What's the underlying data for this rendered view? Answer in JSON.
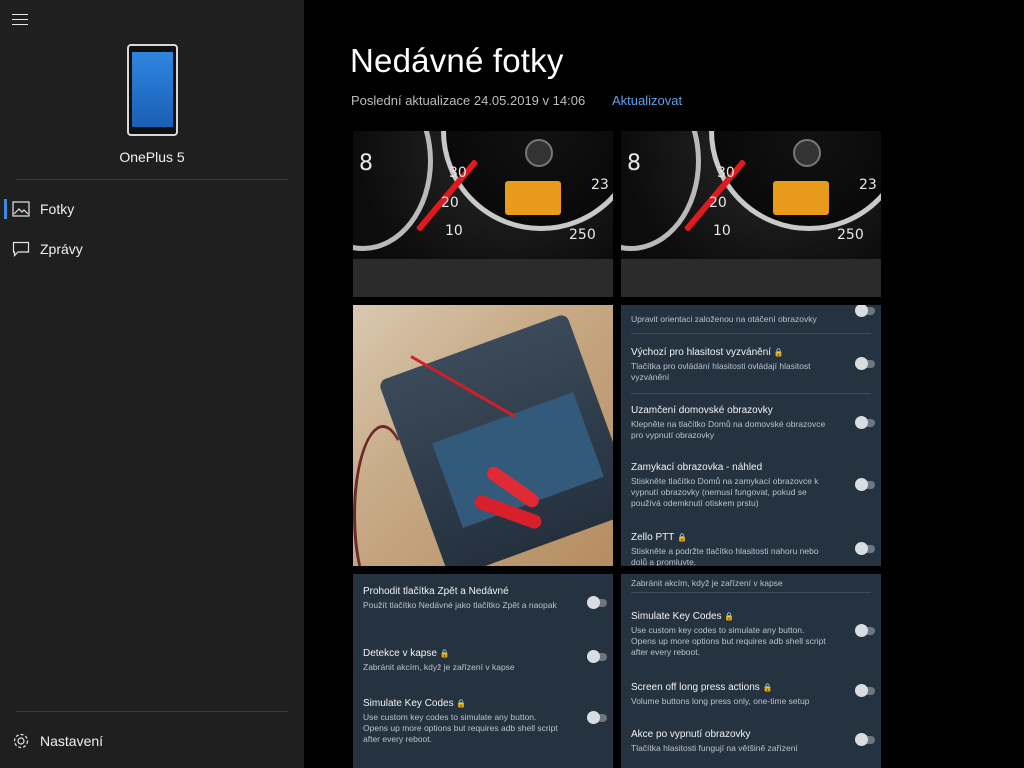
{
  "sidebar": {
    "device_name": "OnePlus 5",
    "nav": [
      {
        "label": "Fotky",
        "icon": "photos-icon",
        "selected": true
      },
      {
        "label": "Zprávy",
        "icon": "messages-icon",
        "selected": false
      }
    ],
    "settings_label": "Nastavení"
  },
  "main": {
    "title": "Nedávné fotky",
    "last_update": "Poslední aktualizace 24.05.2019 v 14:06",
    "refresh_label": "Aktualizovat"
  },
  "gauge": {
    "n30": "30",
    "n20": "20",
    "n10": "10",
    "n23": "23",
    "n250": "250",
    "n8": "8"
  },
  "photo4": {
    "top_partial": "Upravit orientaci založenou na otáčení obrazovky",
    "items": [
      {
        "title": "Výchozí pro hlasitost vyzvánění",
        "desc": "Tlačítka pro ovládání hlasitosti ovládají hlasitost vyzvánění"
      },
      {
        "title": "Uzamčení domovské obrazovky",
        "desc": "Klepněte na tlačítko Domů na domovské obrazovce pro vypnutí obrazovky"
      },
      {
        "title": "Zamykací obrazovka - náhled",
        "desc": "Stiskněte tlačítko Domů na zamykací obrazovce k vypnutí obrazovky (nemusí fungovat, pokud se používá odemknutí otiskem prstu)"
      },
      {
        "title": "Zello PTT",
        "desc": "Stiskněte a podržte tlačítko hlasitosti nahoru nebo dolů a promluvte."
      }
    ]
  },
  "photo5": {
    "items": [
      {
        "title": "Prohodit tlačítka Zpět a Nedávné",
        "desc": "Použít tlačítko Nedávné jako tlačítko Zpět a naopak"
      },
      {
        "title": "Detekce v kapse",
        "desc": "Zabránit akcím, když je zařízení v kapse"
      },
      {
        "title": "Simulate Key Codes",
        "desc": "Use custom key codes to simulate any button. Opens up more options but requires adb shell script after every reboot."
      }
    ]
  },
  "photo6": {
    "top_partial": "Zabránit akcím, když je zařízení v kapse",
    "items": [
      {
        "title": "Simulate Key Codes",
        "desc": "Use custom key codes to simulate any button. Opens up more options but requires adb shell script after every reboot."
      },
      {
        "title": "Screen off long press actions",
        "desc": "Volume buttons long press only, one-time setup"
      },
      {
        "title": "Akce po vypnutí obrazovky",
        "desc": "Tlačítka hlasitosti fungují na většině zařízení"
      }
    ]
  },
  "icons": {
    "lock": "🔒"
  }
}
